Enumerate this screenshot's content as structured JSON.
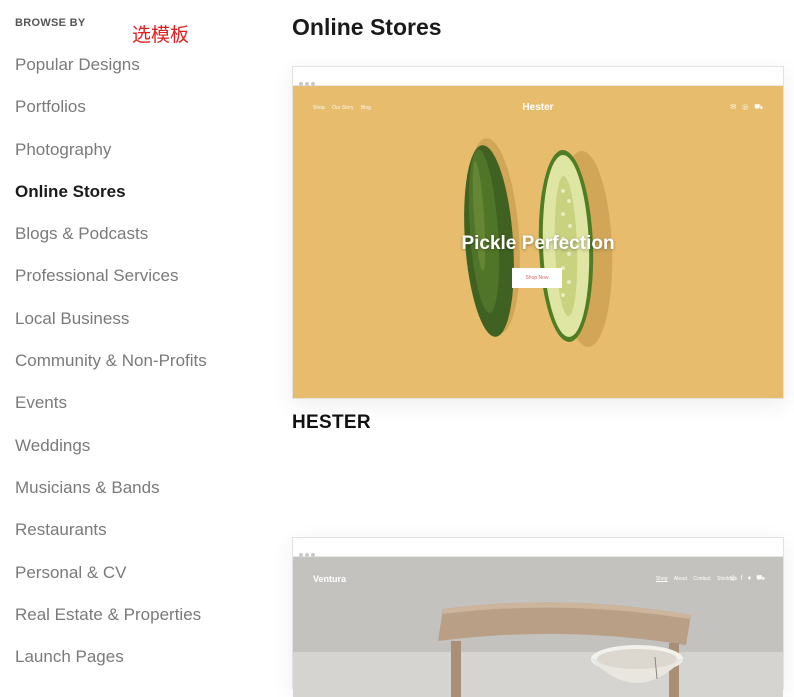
{
  "sidebar": {
    "browse_label": "BROWSE BY",
    "annotation": "选模板",
    "categories": [
      "Popular Designs",
      "Portfolios",
      "Photography",
      "Online Stores",
      "Blogs & Podcasts",
      "Professional Services",
      "Local Business",
      "Community & Non-Profits",
      "Events",
      "Weddings",
      "Musicians & Bands",
      "Restaurants",
      "Personal & CV",
      "Real Estate & Properties",
      "Launch Pages"
    ],
    "active_category": "Online Stores"
  },
  "main": {
    "title": "Online Stores",
    "templates": [
      {
        "name": "HESTER",
        "preview": {
          "nav_items": [
            "Shop",
            "Our Story",
            "Blog"
          ],
          "brand": "Hester",
          "icons": [
            "mail-icon",
            "instagram-icon",
            "cart-icon"
          ],
          "hero_title": "Pickle Perfection",
          "button_label": "Shop Now",
          "background_color": "#e7bd6d",
          "button_text_color": "#d56b6b"
        }
      },
      {
        "name": "Ventura",
        "preview": {
          "brand": "Ventura",
          "nav_items": [
            "Shop",
            "About",
            "Contact",
            "Stockists"
          ],
          "icons": [
            "instagram-icon",
            "facebook-icon",
            "twitter-icon",
            "cart-icon"
          ],
          "background_color": "#c4c2bf"
        }
      }
    ]
  },
  "colors": {
    "active_text": "#1a1a1a",
    "inactive_text": "#7a7a7a",
    "annotation": "#e02020"
  }
}
